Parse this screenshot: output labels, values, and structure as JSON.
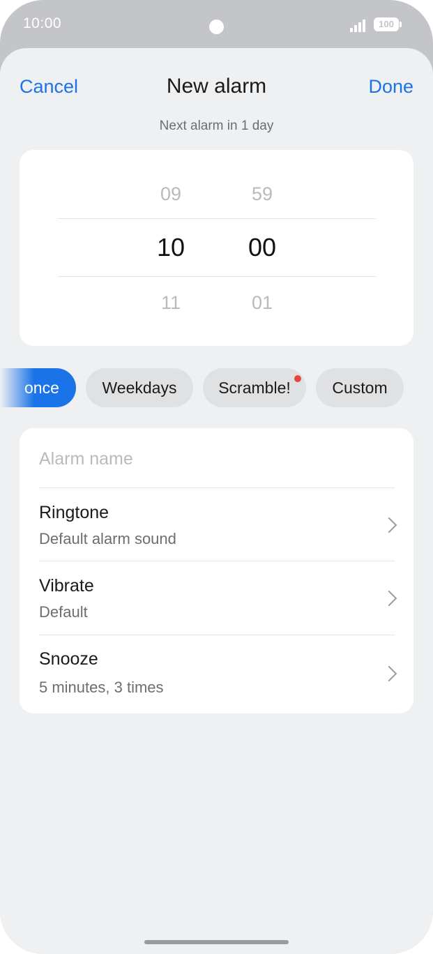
{
  "status_bar": {
    "time": "10:00",
    "battery": "100"
  },
  "nav": {
    "cancel": "Cancel",
    "title": "New alarm",
    "done": "Done",
    "subtitle": "Next alarm in 1 day"
  },
  "time_picker": {
    "hours": {
      "prev": "09",
      "selected": "10",
      "next": "11"
    },
    "minutes": {
      "prev": "59",
      "selected": "00",
      "next": "01"
    }
  },
  "repeat_chips": [
    {
      "label": "once",
      "selected": true
    },
    {
      "label": "Weekdays",
      "selected": false
    },
    {
      "label": "Scramble!",
      "selected": false,
      "badge": true
    },
    {
      "label": "Custom",
      "selected": false
    }
  ],
  "settings": {
    "alarm_name_placeholder": "Alarm name",
    "rows": [
      {
        "title": "Ringtone",
        "subtitle": "Default alarm sound"
      },
      {
        "title": "Vibrate",
        "subtitle": "Default"
      },
      {
        "title": "Snooze",
        "subtitle": "5 minutes, 3 times"
      }
    ]
  },
  "colors": {
    "accent": "#1a73e8",
    "badge": "#e8453c",
    "sheet_background": "#eff0f2"
  }
}
